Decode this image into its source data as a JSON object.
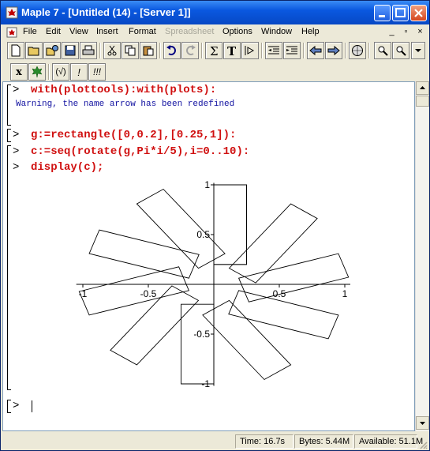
{
  "window": {
    "title": "Maple 7  - [Untitled (14) - [Server 1]]"
  },
  "menu": [
    {
      "label": "File",
      "enabled": true
    },
    {
      "label": "Edit",
      "enabled": true
    },
    {
      "label": "View",
      "enabled": true
    },
    {
      "label": "Insert",
      "enabled": true
    },
    {
      "label": "Format",
      "enabled": true
    },
    {
      "label": "Spreadsheet",
      "enabled": false
    },
    {
      "label": "Options",
      "enabled": true
    },
    {
      "label": "Window",
      "enabled": true
    },
    {
      "label": "Help",
      "enabled": true
    }
  ],
  "mdi_controls": [
    "_",
    "▫",
    "×"
  ],
  "context_toolbar": [
    "x",
    "(√)",
    "!",
    "!!!"
  ],
  "document": {
    "prompt_symbol": ">",
    "lines": [
      {
        "kind": "input",
        "text": "with(plottools):with(plots):"
      },
      {
        "kind": "output",
        "text": "Warning, the name arrow has been redefined"
      },
      {
        "kind": "input",
        "text": "g:=rectangle([0,0.2],[0.25,1]):"
      },
      {
        "kind": "input",
        "text": "c:=seq(rotate(g,Pi*i/5),i=0..10):"
      },
      {
        "kind": "input",
        "text": "display(c);"
      }
    ]
  },
  "plot": {
    "x_ticks": [
      "-1",
      "-0.5",
      "0.5",
      "1"
    ],
    "y_ticks": [
      "1",
      "0.5",
      "-0.5",
      "-1"
    ]
  },
  "chart_data": {
    "type": "line",
    "title": "",
    "xlabel": "",
    "ylabel": "",
    "xlim": [
      -1,
      1
    ],
    "ylim": [
      -1,
      1
    ],
    "x_tick_values": [
      -1,
      -0.5,
      0.5,
      1
    ],
    "y_tick_values": [
      -1,
      -0.5,
      0.5,
      1
    ],
    "grid": false,
    "base_rectangle": {
      "x": [
        0,
        0.25
      ],
      "y": [
        0.2,
        1
      ]
    },
    "rotations_count": 11,
    "rotation_step": "Pi/5"
  },
  "status": {
    "time": "Time:  16.7s",
    "bytes": "Bytes:  5.44M",
    "available": "Available:  51.1M"
  }
}
